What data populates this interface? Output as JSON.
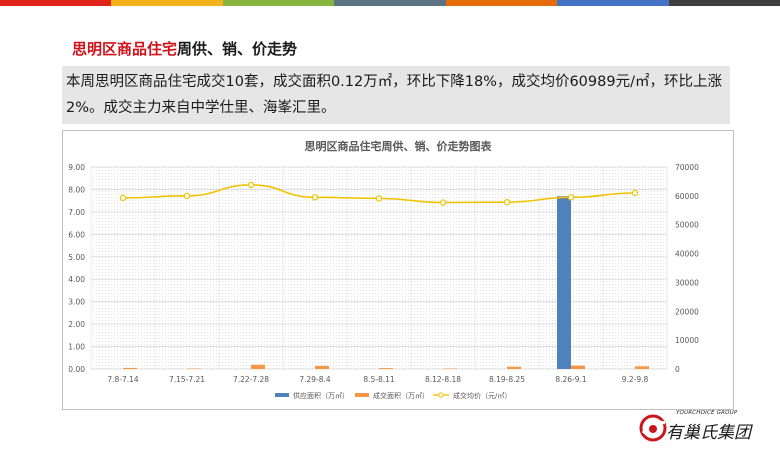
{
  "colors": {
    "top_bar": [
      "#e2231a",
      "#f3b21b",
      "#87b33f",
      "#5c7383",
      "#e46c0a",
      "#4472c4",
      "#3f3f3f"
    ],
    "supply": "#4f81bd",
    "deal_area": "#f79646",
    "deal_price": "#f2c200",
    "title_red": "#d0121b"
  },
  "header": {
    "title_red": "思明区商品住宅",
    "title_black": "周供、销、价走势"
  },
  "summary": {
    "text": "本周思明区商品住宅成交10套，成交面积0.12万㎡，环比下降18%，成交均价60989元/㎡，环比上涨2%。成交主力来自中学仕里、海峯汇里。"
  },
  "logo": {
    "sub": "YOURCHOICE GROUP",
    "main": "有巢氏集团",
    "mark_icon": "swirl-logo-icon"
  },
  "chart_data": {
    "type": "bar",
    "title": "思明区商品住宅周供、销、价走势图表",
    "categories": [
      "7.8-7.14",
      "7.15-7.21",
      "7.22-7.28",
      "7.29-8.4",
      "8.5-8.11",
      "8.12-8.18",
      "8.19-8.25",
      "8.26-9.1",
      "9.2-9.8"
    ],
    "series": [
      {
        "name": "供应面积（万㎡）",
        "type": "bar",
        "axis": "left",
        "values": [
          0,
          0,
          0,
          0,
          0,
          0,
          0,
          7.7,
          0
        ]
      },
      {
        "name": "成交面积（万㎡）",
        "type": "bar",
        "axis": "left",
        "values": [
          0.05,
          0.02,
          0.19,
          0.14,
          0.04,
          0.02,
          0.1,
          0.15,
          0.12
        ]
      },
      {
        "name": "成交均价（元/㎡）",
        "type": "line",
        "axis": "right",
        "values": [
          59300,
          60000,
          63800,
          59500,
          59100,
          57700,
          57800,
          59500,
          60989
        ]
      }
    ],
    "y_left": {
      "min": 0,
      "max": 9,
      "ticks": [
        "0.00",
        "1.00",
        "2.00",
        "3.00",
        "4.00",
        "5.00",
        "6.00",
        "7.00",
        "8.00",
        "9.00"
      ]
    },
    "y_right": {
      "min": 0,
      "max": 70000,
      "ticks": [
        "0",
        "10000",
        "20000",
        "30000",
        "40000",
        "50000",
        "60000",
        "70000"
      ]
    },
    "grid": true,
    "legend_position": "bottom"
  }
}
